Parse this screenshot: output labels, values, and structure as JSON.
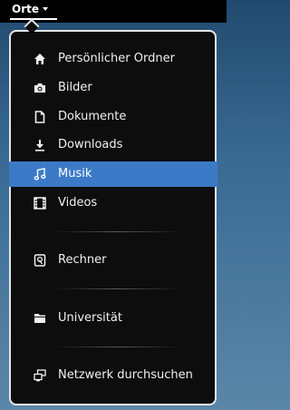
{
  "topbar": {
    "menu_label": "Orte"
  },
  "menu": {
    "items": [
      {
        "label": "Persönlicher Ordner",
        "icon": "home-icon"
      },
      {
        "label": "Bilder",
        "icon": "camera-icon"
      },
      {
        "label": "Dokumente",
        "icon": "document-icon"
      },
      {
        "label": "Downloads",
        "icon": "download-icon"
      },
      {
        "label": "Musik",
        "icon": "music-icon",
        "selected": true
      },
      {
        "label": "Videos",
        "icon": "film-icon"
      },
      {
        "label": "Rechner",
        "icon": "drive-icon"
      },
      {
        "label": "Universität",
        "icon": "folder-icon"
      },
      {
        "label": "Netzwerk durchsuchen",
        "icon": "network-icon"
      }
    ],
    "selected_color": "#3c7ac8"
  }
}
